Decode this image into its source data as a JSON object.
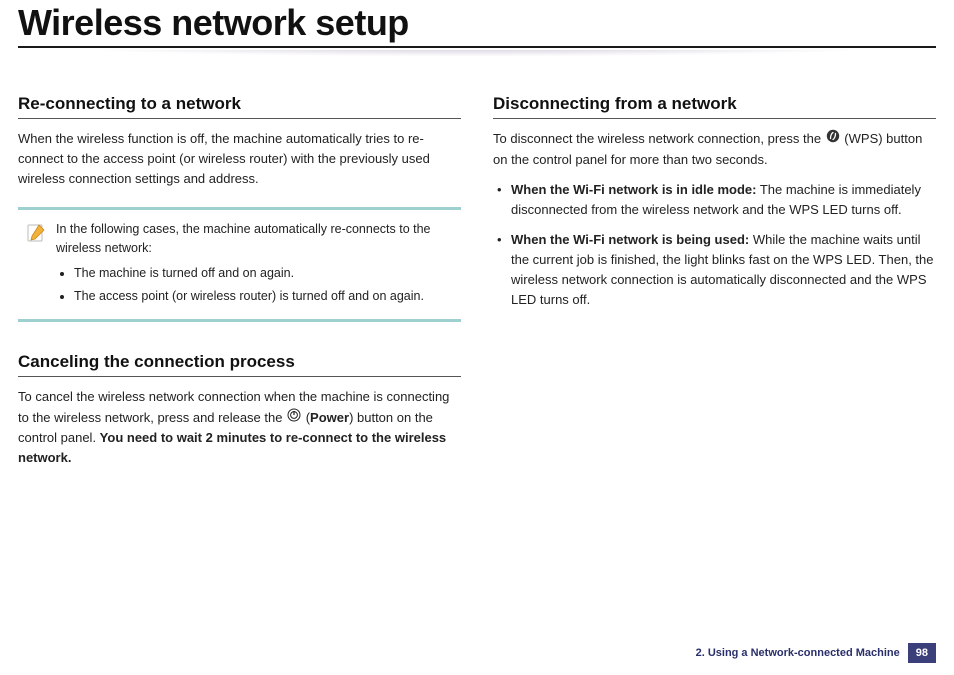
{
  "title": "Wireless network setup",
  "left": {
    "h_reconnect": "Re-connecting to a network",
    "p_reconnect": "When the wireless function is off, the machine automatically tries to re-connect to the access point (or wireless router) with the previously used wireless connection settings and address.",
    "note_intro": "In the following cases, the machine automatically re-connects to the wireless network:",
    "note_items": [
      "The machine is turned off and on again.",
      "The access point (or wireless router) is turned off and on again."
    ],
    "h_cancel": "Canceling the connection process",
    "p_cancel_1": "To cancel the wireless network connection when the machine is connecting to the wireless network, press and release the ",
    "p_cancel_power": "Power",
    "p_cancel_2": ") button on the control panel. ",
    "p_cancel_bold": "You need to wait 2 minutes to re-connect to the wireless network."
  },
  "right": {
    "h_disconnect": "Disconnecting from a network",
    "p_disc_1": "To disconnect the wireless network connection, press the ",
    "p_disc_2": " (WPS) button on the control panel for more than two seconds.",
    "bullet1_bold": "When the Wi-Fi network is in idle mode:",
    "bullet1_rest": " The machine is immediately disconnected from the wireless network and the WPS LED turns off.",
    "bullet2_bold": "When the Wi-Fi network is being used:",
    "bullet2_rest": " While the machine waits until the current job is finished, the light blinks fast on the WPS LED. Then, the wireless network connection is automatically disconnected and the WPS LED turns off."
  },
  "footer": {
    "chapter": "2.  Using a Network-connected Machine",
    "page": "98"
  }
}
